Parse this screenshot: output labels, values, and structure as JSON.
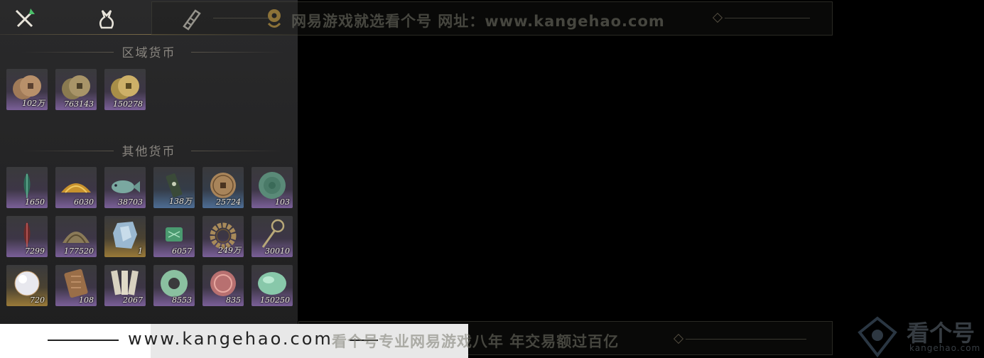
{
  "tabs": [
    {
      "name": "weapons-tab",
      "icon": "crossed-swords-icon"
    },
    {
      "name": "items-tab",
      "icon": "pouch-icon"
    },
    {
      "name": "scrolls-tab",
      "icon": "scroll-icon"
    },
    {
      "name": "currency-tab",
      "icon": "coin-icon",
      "active": true
    }
  ],
  "sections": {
    "regional": {
      "title": "区域货币",
      "items": [
        {
          "icon": "copper-coins-icon",
          "qty": "102万",
          "rarity": "purple"
        },
        {
          "icon": "bronze-coins-icon",
          "qty": "763143",
          "rarity": "purple"
        },
        {
          "icon": "gold-coins-icon",
          "qty": "150278",
          "rarity": "purple"
        }
      ]
    },
    "other": {
      "title": "其他货币",
      "items": [
        {
          "icon": "green-feather-icon",
          "qty": "1650",
          "rarity": "purple"
        },
        {
          "icon": "golden-pile-icon",
          "qty": "6030",
          "rarity": "purple"
        },
        {
          "icon": "jade-fish-icon",
          "qty": "38703",
          "rarity": "purple"
        },
        {
          "icon": "bamboo-token-icon",
          "qty": "138万",
          "rarity": "blue"
        },
        {
          "icon": "bronze-coin-icon",
          "qty": "25724",
          "rarity": "blue"
        },
        {
          "icon": "jade-disc-icon",
          "qty": "103",
          "rarity": "purple"
        },
        {
          "icon": "red-feather-icon",
          "qty": "7299",
          "rarity": "purple"
        },
        {
          "icon": "bronze-dome-icon",
          "qty": "177520",
          "rarity": "purple"
        },
        {
          "icon": "crystal-stone-icon",
          "qty": "1",
          "rarity": "gold"
        },
        {
          "icon": "green-talisman-icon",
          "qty": "6057",
          "rarity": "purple"
        },
        {
          "icon": "bead-bracelet-icon",
          "qty": "249万",
          "rarity": "purple"
        },
        {
          "icon": "coin-sword-icon",
          "qty": "30010",
          "rarity": "purple"
        },
        {
          "icon": "pearl-icon",
          "qty": "720",
          "rarity": "gold"
        },
        {
          "icon": "carved-plaque-icon",
          "qty": "108",
          "rarity": "purple"
        },
        {
          "icon": "bamboo-slips-icon",
          "qty": "2067",
          "rarity": "purple"
        },
        {
          "icon": "jade-ring-icon",
          "qty": "8553",
          "rarity": "purple"
        },
        {
          "icon": "red-medallion-icon",
          "qty": "835",
          "rarity": "purple"
        },
        {
          "icon": "jade-pebble-icon",
          "qty": "150250",
          "rarity": "purple"
        }
      ]
    }
  },
  "watermark": {
    "top_text": "网易游戏就选看个号   网址：www.kangehao.com",
    "bottom_text": "看个号专业网易游戏八年   年交易额过百亿",
    "url": "www.kangehao.com",
    "logo_text": "看个号",
    "logo_sub": "kangehao.com"
  },
  "colors": {
    "purple": "#7a5f98",
    "blue": "#4d6d94",
    "gold": "#9a7a38",
    "accent": "#c9a24a"
  }
}
